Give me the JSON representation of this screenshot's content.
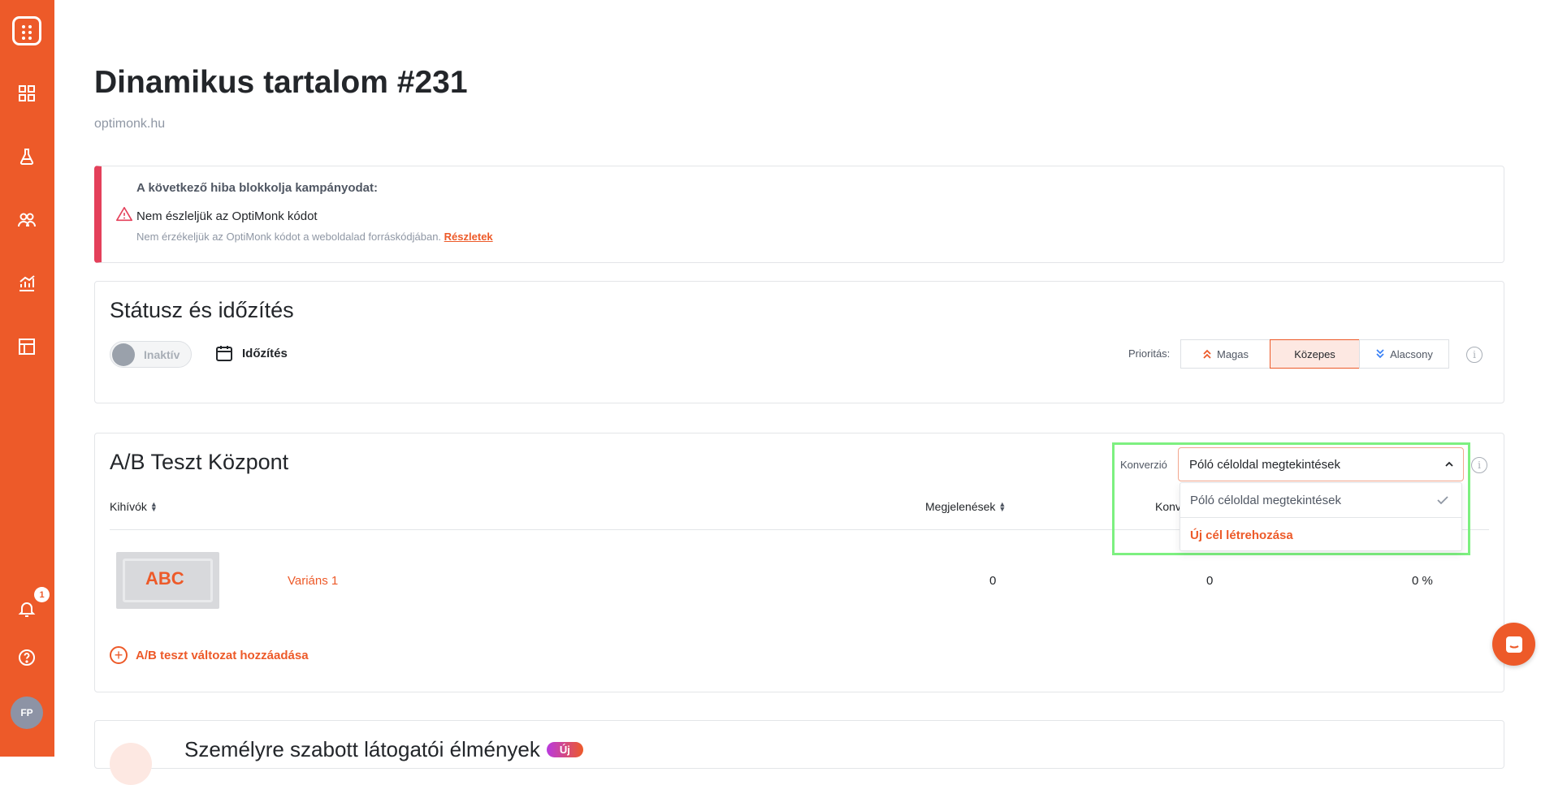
{
  "sidebar": {
    "notification_count": "1",
    "avatar_initials": "FP"
  },
  "page": {
    "title": "Dinamikus tartalom #231",
    "domain": "optimonk.hu"
  },
  "error": {
    "title": "A következő hiba blokkolja kampányodat:",
    "message": "Nem észleljük az OptiMonk kódot",
    "detail": "Nem érzékeljük az OptiMonk kódot a weboldalad forráskódjában.",
    "link": "Részletek"
  },
  "status": {
    "title": "Státusz és időzítés",
    "toggle_label": "Inaktív",
    "schedule_label": "Időzítés",
    "priority_label": "Prioritás:",
    "priority_high": "Magas",
    "priority_medium": "Közepes",
    "priority_low": "Alacsony"
  },
  "ab": {
    "title": "A/B Teszt Központ",
    "conversion_label": "Konverzió",
    "conversion_selected": "Póló céloldal megtekintések",
    "dropdown_options": [
      "Póló céloldal megtekintések",
      "Új cél létrehozása"
    ],
    "col_headers": [
      "Kihívók",
      "Megjelenések",
      "Konv"
    ],
    "variant": {
      "thumb_text": "ABC",
      "name": "Variáns 1",
      "impressions": "0",
      "conversions": "0",
      "rate": "0 %"
    },
    "add_variant": "A/B teszt változat hozzáadása"
  },
  "experience": {
    "title": "Személyre szabott látogatói élmények",
    "badge": "Új"
  },
  "colors": {
    "brand": "#ed5a29",
    "error": "#e4405a",
    "highlight": "#7df080"
  }
}
